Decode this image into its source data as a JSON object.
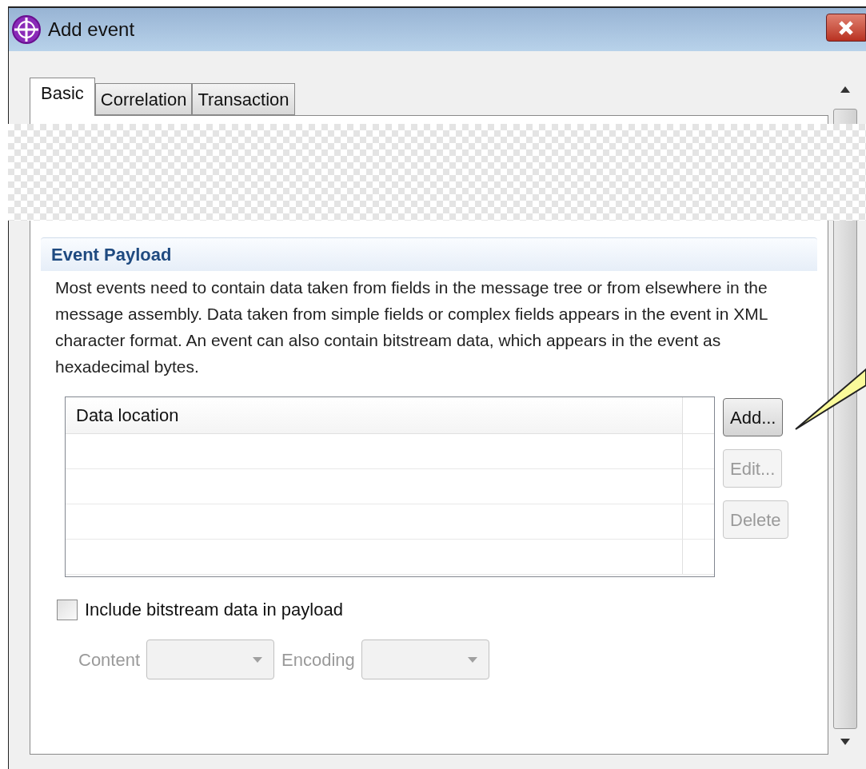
{
  "window": {
    "title": "Add event"
  },
  "tabs": [
    {
      "label": "Basic",
      "selected": true
    },
    {
      "label": "Correlation",
      "selected": false
    },
    {
      "label": "Transaction",
      "selected": false
    }
  ],
  "section": {
    "title": "Event Payload",
    "description": "Most events need to contain data taken from fields in the message tree or from elsewhere in the message assembly. Data taken from simple fields or complex fields appears in the event in XML character format. An event can also contain bitstream data, which appears in the event as hexadecimal bytes."
  },
  "table": {
    "columns": [
      "Data location"
    ]
  },
  "buttons": [
    {
      "label": "Add...",
      "disabled": false
    },
    {
      "label": "Edit...",
      "disabled": true
    },
    {
      "label": "Delete",
      "disabled": true
    }
  ],
  "checkbox": {
    "label": "Include bitstream data in payload",
    "checked": false
  },
  "combos": [
    {
      "label": "Content",
      "disabled": true
    },
    {
      "label": "Encoding",
      "disabled": true
    }
  ]
}
